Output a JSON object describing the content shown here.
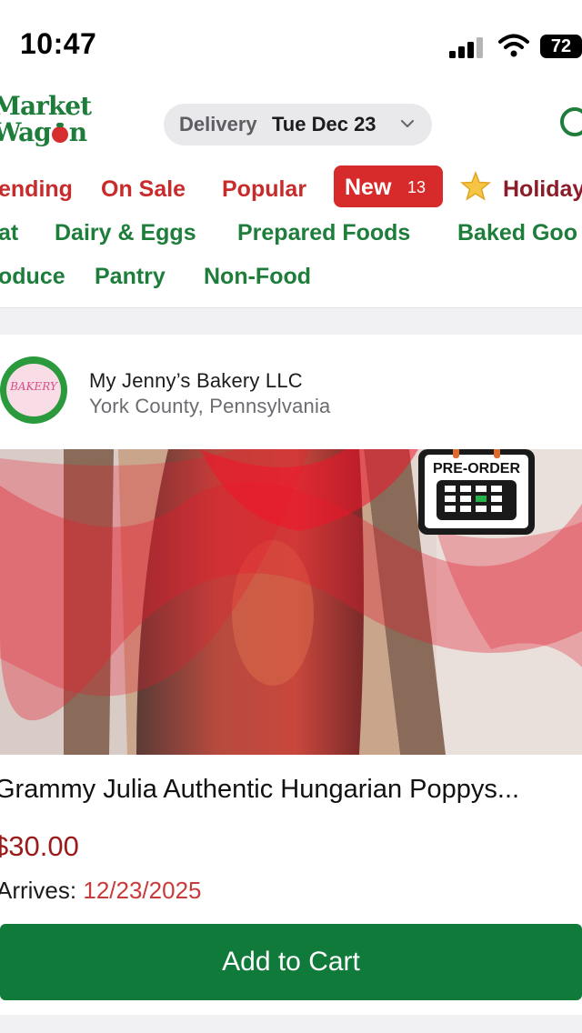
{
  "status_bar": {
    "time": "10:47",
    "battery": "72"
  },
  "header": {
    "logo_line1": "Market",
    "logo_line2_a": "Wag",
    "logo_line2_b": "n",
    "delivery_label": "Delivery",
    "delivery_date": "Tue Dec 23"
  },
  "nav": {
    "row1": [
      "ending",
      "On Sale",
      "Popular"
    ],
    "new_label": "New",
    "new_count": "13",
    "holiday": "Holiday",
    "row2": [
      "at",
      "Dairy & Eggs",
      "Prepared Foods",
      "Baked Goo"
    ],
    "row3": [
      "oduce",
      "Pantry",
      "Non-Food"
    ]
  },
  "product": {
    "vendor_name": "My Jenny’s Bakery LLC",
    "vendor_location": "York County, Pennsylvania",
    "vendor_logo_text": "BAKERY",
    "badge": "PRE-ORDER",
    "title": "Grammy Julia Authentic Hungarian Poppys...",
    "price": "$30.00",
    "arrives_label": "Arrives:",
    "arrives_date": "12/23/2025",
    "add_to_cart": "Add to Cart"
  },
  "colors": {
    "brand_green": "#1e7d3a",
    "sale_red": "#c72b2b",
    "price_red": "#9b1b1b",
    "button_green": "#0f7a39"
  },
  "icons": [
    "signal-icon",
    "wifi-icon",
    "battery-icon",
    "chevron-down-icon",
    "search-icon",
    "star-icon",
    "calendar-icon"
  ]
}
